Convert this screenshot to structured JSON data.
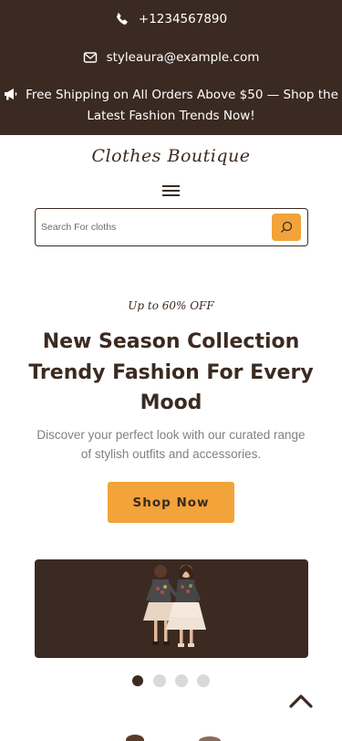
{
  "topbar": {
    "phone": "+1234567890",
    "email": "styleaura@example.com",
    "promo": "Free Shipping on All Orders Above $50 — Shop the Latest Fashion Trends Now!",
    "phone_icon": "phone-icon",
    "email_icon": "envelope-icon",
    "promo_icon": "megaphone-icon"
  },
  "header": {
    "logo": "Clothes Boutique",
    "menu_icon": "hamburger-menu-icon",
    "search": {
      "placeholder": "Search For cloths",
      "value": "",
      "icon": "search-icon"
    }
  },
  "hero": {
    "tagline": "Up to 60% OFF",
    "headline": "New Season Collection Trendy Fashion For Every Mood",
    "subtext": "Discover your perfect look with our curated range of stylish outfits and accessories.",
    "cta": "Shop Now",
    "slider": {
      "slide_count": 4,
      "active_index": 0
    },
    "scroll_top_icon": "chevron-up-icon"
  },
  "colors": {
    "primary": "#3b2a21",
    "accent": "#f2a33a",
    "background": "#ffffff",
    "muted_text": "#808080"
  }
}
